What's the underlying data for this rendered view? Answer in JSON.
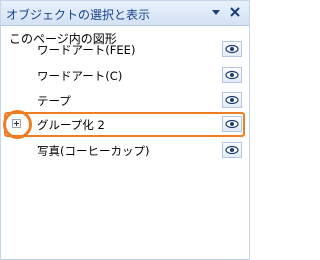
{
  "panel": {
    "title": "オブジェクトの選択と表示",
    "dropdown_icon": "chevron-down-icon",
    "close_icon": "close-icon"
  },
  "section": {
    "label": "このページ内の図形"
  },
  "items": [
    {
      "label": "ワードアート(FEE)",
      "visible_icon": "eye-icon"
    },
    {
      "label": "ワードアート(C)",
      "visible_icon": "eye-icon"
    },
    {
      "label": "テープ",
      "visible_icon": "eye-icon"
    },
    {
      "label": "グループ化 2",
      "visible_icon": "eye-icon",
      "expand_icon": "plus-box-icon",
      "highlighted": true
    },
    {
      "label": "写真(コーヒーカップ)",
      "visible_icon": "eye-icon"
    }
  ],
  "colors": {
    "highlight": "#ef7d23",
    "title_text": "#15428b",
    "header_bg": "#d4e2f4"
  }
}
